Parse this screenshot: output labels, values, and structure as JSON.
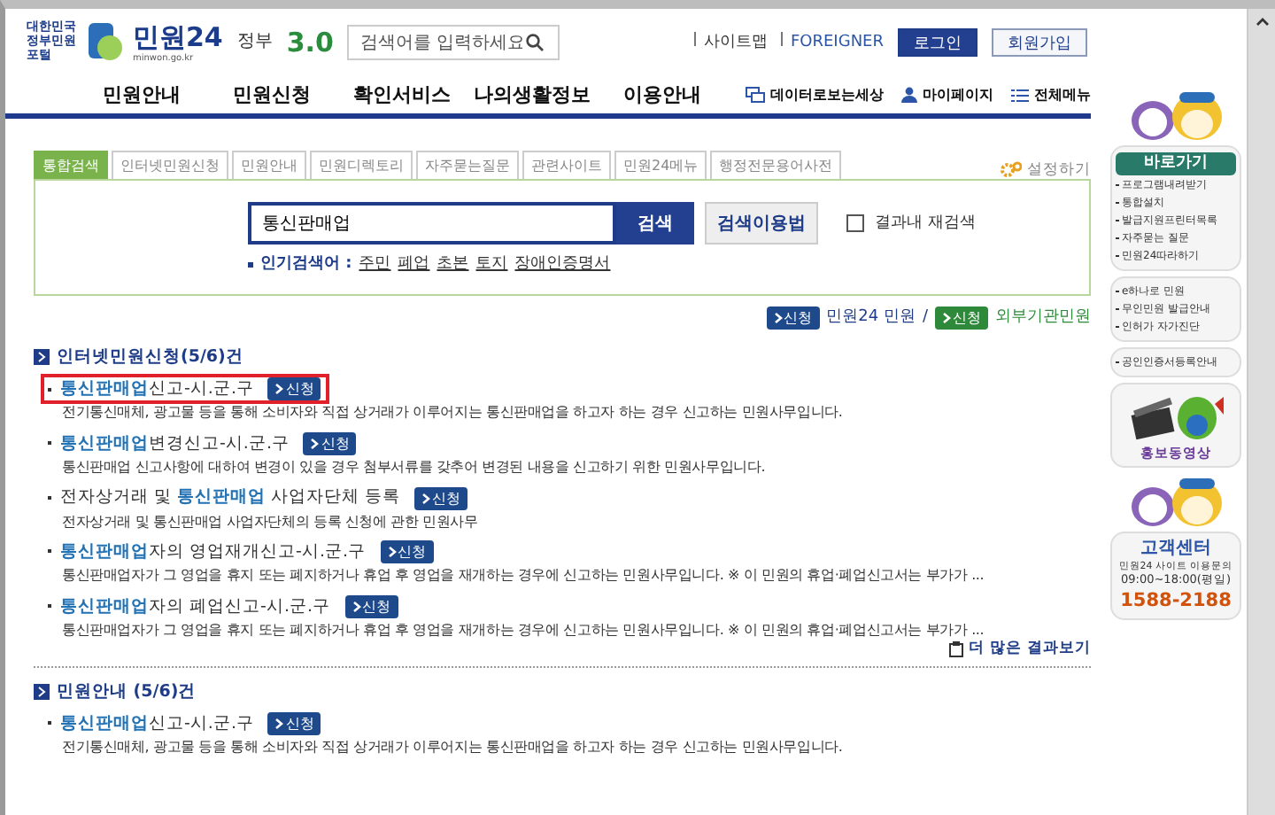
{
  "header": {
    "logo": {
      "caption": "대한민국 정부민원포털",
      "name": "민원24",
      "domain": "minwon.go.kr"
    },
    "gov": {
      "label": "정부",
      "version": "3.0"
    },
    "search": {
      "placeholder": "검색어를 입력하세요"
    },
    "links": [
      "사이트맵",
      "FOREIGNER"
    ],
    "buttons": [
      {
        "label": "로그인",
        "kind": "primary"
      },
      {
        "label": "회원가입",
        "kind": "secondary"
      }
    ]
  },
  "nav": {
    "items": [
      "민원안내",
      "민원신청",
      "확인서비스",
      "나의생활정보",
      "이용안내"
    ],
    "quick": [
      {
        "label": "데이터로보는세상",
        "kind": "data"
      },
      {
        "label": "마이페이지",
        "kind": "user"
      },
      {
        "label": "전체메뉴",
        "kind": "menu"
      }
    ]
  },
  "tabs": [
    {
      "label": "통합검색",
      "selected": true
    },
    {
      "label": "인터넷민원신청",
      "selected": false
    },
    {
      "label": "민원안내",
      "selected": false
    },
    {
      "label": "민원디렉토리",
      "selected": false
    },
    {
      "label": "자주묻는질문",
      "selected": false
    },
    {
      "label": "관련사이트",
      "selected": false
    },
    {
      "label": "민원24메뉴",
      "selected": false
    },
    {
      "label": "행정전문용어사전",
      "selected": false
    }
  ],
  "settings": "설정하기",
  "search": {
    "value": "통신판매업",
    "button": "검색",
    "help": "검색이용법",
    "within": {
      "label": "결과내 재검색",
      "checked": false
    },
    "popular_label": "인기검색어 :",
    "popular": [
      "주민",
      "폐업",
      "초본",
      "토지",
      "장애인증명서"
    ]
  },
  "legend": [
    {
      "badge": "신청",
      "label": "민원24 민원",
      "kind": "internal"
    },
    {
      "kind": "separator",
      "label": "/"
    },
    {
      "badge": "신청",
      "label": "외부기관민원",
      "kind": "external"
    }
  ],
  "sections": [
    {
      "title": "인터넷민원신청(5/6)건",
      "items": [
        {
          "match": "통신판매업",
          "after": "신고-시.군.구",
          "action": "신청",
          "highlighted": true,
          "desc": "전기통신매체, 광고물 등을 통해 소비자와 직접 상거래가 이루어지는 통신판매업을 하고자 하는 경우 신고하는 민원사무입니다."
        },
        {
          "match": "통신판매업",
          "after": "변경신고-시.군.구",
          "action": "신청",
          "highlighted": false,
          "desc": "통신판매업 신고사항에 대하여 변경이 있을 경우 첨부서류를 갖추어 변경된 내용을 신고하기 위한 민원사무입니다."
        },
        {
          "before": "전자상거래 및 ",
          "match": "통신판매업",
          "after": " 사업자단체 등록",
          "action": "신청",
          "highlighted": false,
          "desc": "전자상거래 및 통신판매업 사업자단체의 등록 신청에 관한 민원사무"
        },
        {
          "match": "통신판매업",
          "after": "자의 영업재개신고-시.군.구",
          "action": "신청",
          "highlighted": false,
          "desc": "통신판매업자가 그 영업을 휴지 또는 폐지하거나 휴업 후 영업을 재개하는 경우에 신고하는 민원사무입니다. ※ 이 민원의 휴업·폐업신고서는 부가가 ..."
        },
        {
          "match": "통신판매업",
          "after": "자의 폐업신고-시.군.구",
          "action": "신청",
          "highlighted": false,
          "desc": "통신판매업자가 그 영업을 휴지 또는 폐지하거나 휴업 후 영업을 재개하는 경우에 신고하는 민원사무입니다. ※ 이 민원의 휴업·폐업신고서는 부가가 ..."
        }
      ],
      "more": "더 많은 결과보기"
    },
    {
      "title": "민원안내 (5/6)건",
      "items": [
        {
          "match": "통신판매업",
          "after": "신고-시.군.구",
          "action": "신청",
          "highlighted": false,
          "desc": "전기통신매체, 광고물 등을 통해 소비자와 직접 상거래가 이루어지는 통신판매업을 하고자 하는 경우 신고하는 민원사무입니다."
        }
      ]
    }
  ],
  "sidebar": {
    "quick_title": "바로가기",
    "groups": [
      [
        "프로그램내려받기",
        "통합설치",
        "발급지원프린터목록",
        "자주묻는 질문",
        "민원24따라하기"
      ],
      [
        "e하나로 민원",
        "무인민원 발급안내",
        "인허가 자가진단"
      ],
      [
        "공인인증서등록안내"
      ]
    ],
    "video": "홍보동영상",
    "center": {
      "title": "고객센터",
      "subtitle": "민원24 사이트 이용문의",
      "hours": "09:00~18:00(평일)",
      "phone": "1588-2188"
    }
  }
}
